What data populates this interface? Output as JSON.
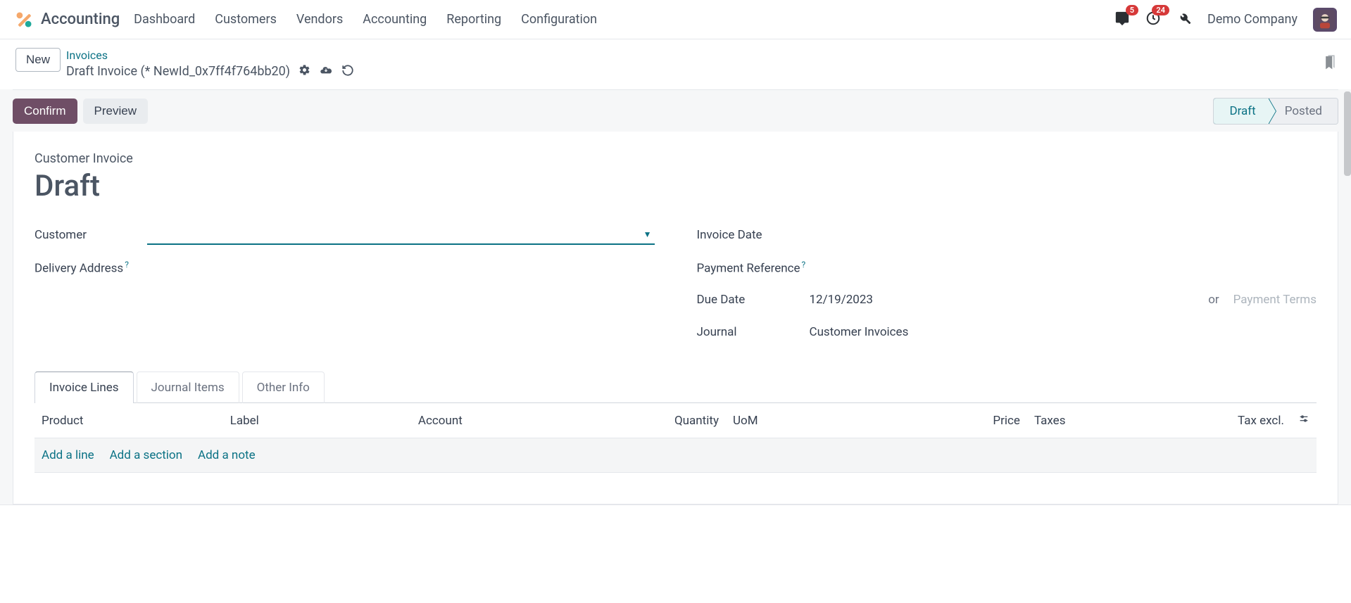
{
  "app": {
    "title": "Accounting"
  },
  "menu": [
    "Dashboard",
    "Customers",
    "Vendors",
    "Accounting",
    "Reporting",
    "Configuration"
  ],
  "systray": {
    "messages_badge": "5",
    "activities_badge": "24",
    "company": "Demo Company"
  },
  "controls": {
    "new_button": "New",
    "crumb_parent": "Invoices",
    "crumb_current": "Draft Invoice (* NewId_0x7ff4f764bb20)"
  },
  "statusbar": {
    "confirm": "Confirm",
    "preview": "Preview",
    "steps": {
      "draft": "Draft",
      "posted": "Posted"
    }
  },
  "doc": {
    "type_label": "Customer Invoice",
    "title": "Draft",
    "left_labels": {
      "customer": "Customer",
      "delivery": "Delivery Address"
    },
    "right_labels": {
      "invoice_date": "Invoice Date",
      "payment_ref": "Payment Reference",
      "due_date": "Due Date",
      "journal": "Journal"
    },
    "values": {
      "invoice_date": "",
      "payment_ref": "",
      "due_date": "12/19/2023",
      "due_or": "or",
      "payment_terms_ph": "Payment Terms",
      "journal": "Customer Invoices"
    }
  },
  "tabs": {
    "invoice_lines": "Invoice Lines",
    "journal_items": "Journal Items",
    "other_info": "Other Info"
  },
  "columns": {
    "product": "Product",
    "label": "Label",
    "account": "Account",
    "quantity": "Quantity",
    "uom": "UoM",
    "price": "Price",
    "taxes": "Taxes",
    "tax_excl": "Tax excl."
  },
  "add_actions": {
    "line": "Add a line",
    "section": "Add a section",
    "note": "Add a note"
  }
}
